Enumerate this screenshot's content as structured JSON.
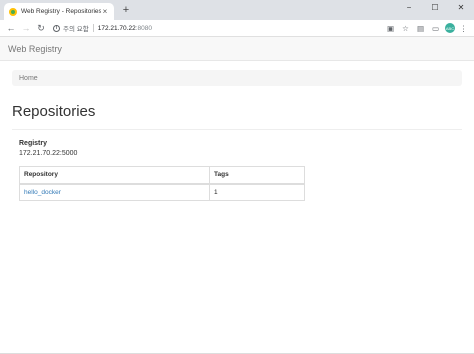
{
  "browser": {
    "tab_title": "Web Registry - Repositories",
    "security_text": "주의 요함",
    "url_host": "172.21.70.22",
    "url_port": ":8080",
    "avatar_text": "ABC"
  },
  "navbar": {
    "brand": "Web Registry"
  },
  "breadcrumb": {
    "items": [
      "Home"
    ]
  },
  "page": {
    "title": "Repositories",
    "registry_label": "Registry",
    "registry_value": "172.21.70.22:5000"
  },
  "table": {
    "headers": [
      "Repository",
      "Tags"
    ],
    "rows": [
      {
        "repository": "hello_docker",
        "tags": "1"
      }
    ]
  }
}
